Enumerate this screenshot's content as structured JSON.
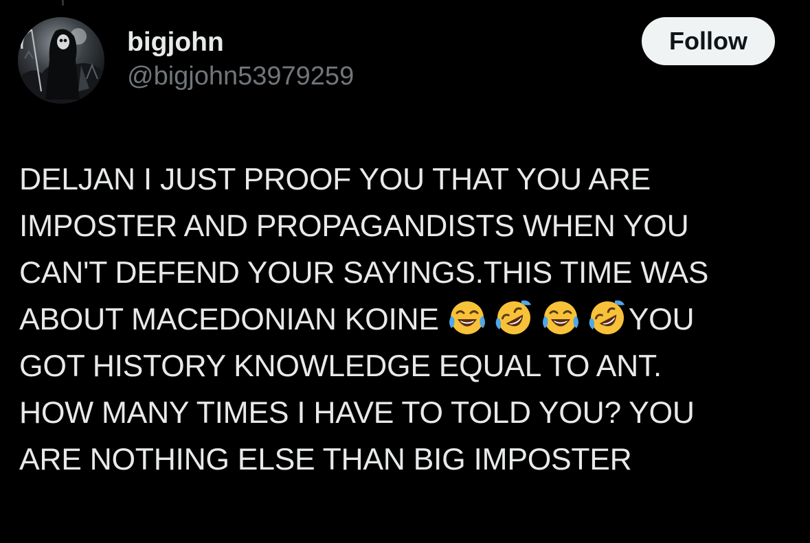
{
  "author": {
    "display_name": "bigjohn",
    "handle": "@bigjohn53979259",
    "avatar_icon": "grim-reaper-avatar"
  },
  "actions": {
    "follow_label": "Follow"
  },
  "tweet": {
    "lines": [
      "DELJAN I JUST PROOF YOU THAT YOU ARE",
      "IMPOSTER AND PROPAGANDISTS WHEN YOU",
      "CAN'T DEFEND YOUR SAYINGS.THIS TIME WAS",
      "ABOUT MACEDONIAN KOINE ",
      "GOT HISTORY KNOWLEDGE EQUAL TO ANT.",
      "HOW MANY TIMES I HAVE TO TOLD YOU? YOU",
      "ARE NOTHING ELSE THAN BIG IMPOSTER"
    ],
    "line4_suffix": "YOU",
    "emojis": [
      "face-with-tears-of-joy-icon",
      "rolling-on-floor-laughing-icon",
      "face-with-tears-of-joy-icon",
      "rolling-on-floor-laughing-icon"
    ]
  },
  "colors": {
    "background": "#000000",
    "text_primary": "#e7e9ea",
    "text_secondary": "#71767b",
    "follow_bg": "#eff3f4",
    "follow_text": "#0f1419"
  }
}
